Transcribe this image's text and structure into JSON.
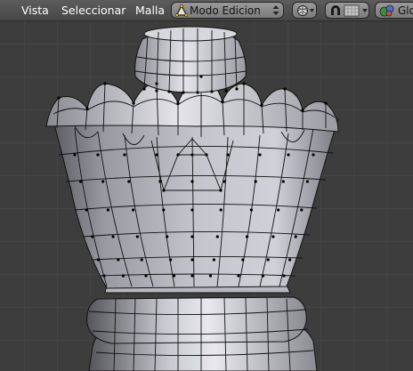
{
  "header": {
    "menus": [
      {
        "label": "Vista"
      },
      {
        "label": "Seleccionar"
      },
      {
        "label": "Malla"
      }
    ],
    "mode_select": {
      "selected": "Modo Edicion",
      "icon": "edit-mode-triangle-icon"
    },
    "shading_button": {
      "icon": "solid-shading-sphere-icon"
    },
    "proportional_button": {
      "icon": "magnet-icon",
      "secondary_icon": "snap-grid-icon"
    },
    "orientation_select": {
      "selected": "Glo",
      "icon": "global-orientation-icon"
    }
  },
  "viewport": {
    "object": "chess-piece-crown-mesh",
    "background_color": "#3d3d3d",
    "grid_color": "#4a4a4a",
    "wire_color": "#000000",
    "vertex_color": "#000000"
  }
}
